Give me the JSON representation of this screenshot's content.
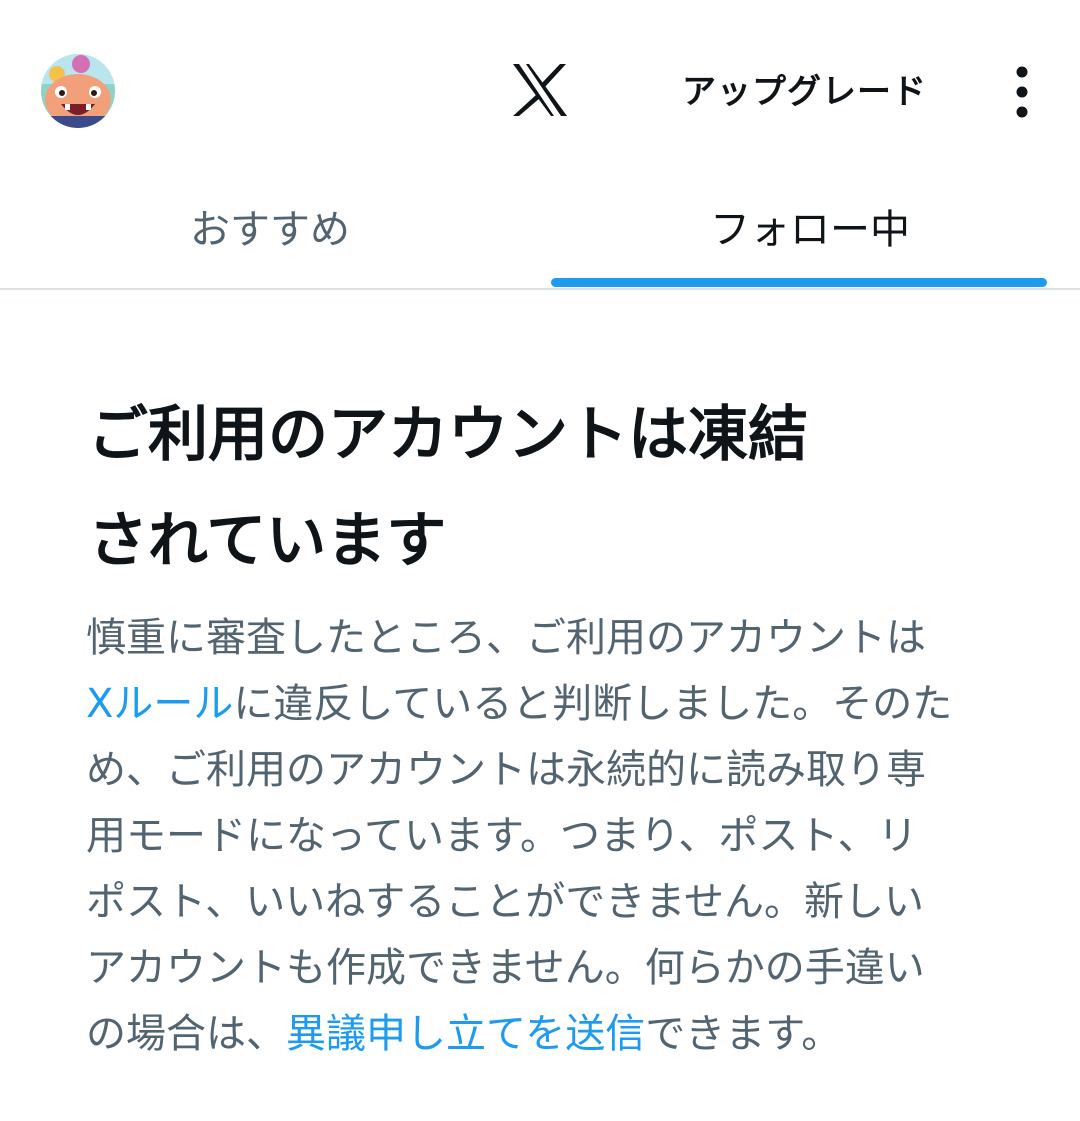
{
  "header": {
    "avatar_icon": "cartoon-avatar-icon",
    "logo_icon": "x-logo-icon",
    "upgrade_label": "アップグレード",
    "more_icon": "more-vertical-icon"
  },
  "tabs": [
    {
      "label": "おすすめ",
      "selected": false
    },
    {
      "label": "フォロー中",
      "selected": true
    }
  ],
  "notice": {
    "title_line1": "ご利用のアカウントは凍結",
    "title_line2": "されています",
    "body": {
      "line1": "慎重に審査したところ、ご利用のアカウントは",
      "rules_link": "Xルール",
      "line2_rest": "に違反していると判断しました。そのた",
      "line3": "め、ご利用のアカウントは永続的に読み取り専",
      "line4": "用モードになっています。つまり、ポスト、リ",
      "line5": "ポスト、いいねすることができません。新しい",
      "line6": "アカウントも作成できません。何らかの手違い",
      "line7_pre": "の場合は、",
      "appeal_link": "異議申し立てを送信",
      "line7_post": "できます。"
    }
  },
  "colors": {
    "accent": "#1d9bf0",
    "text_primary": "#0f1419",
    "text_secondary": "#536471",
    "divider": "#dce1e4"
  }
}
